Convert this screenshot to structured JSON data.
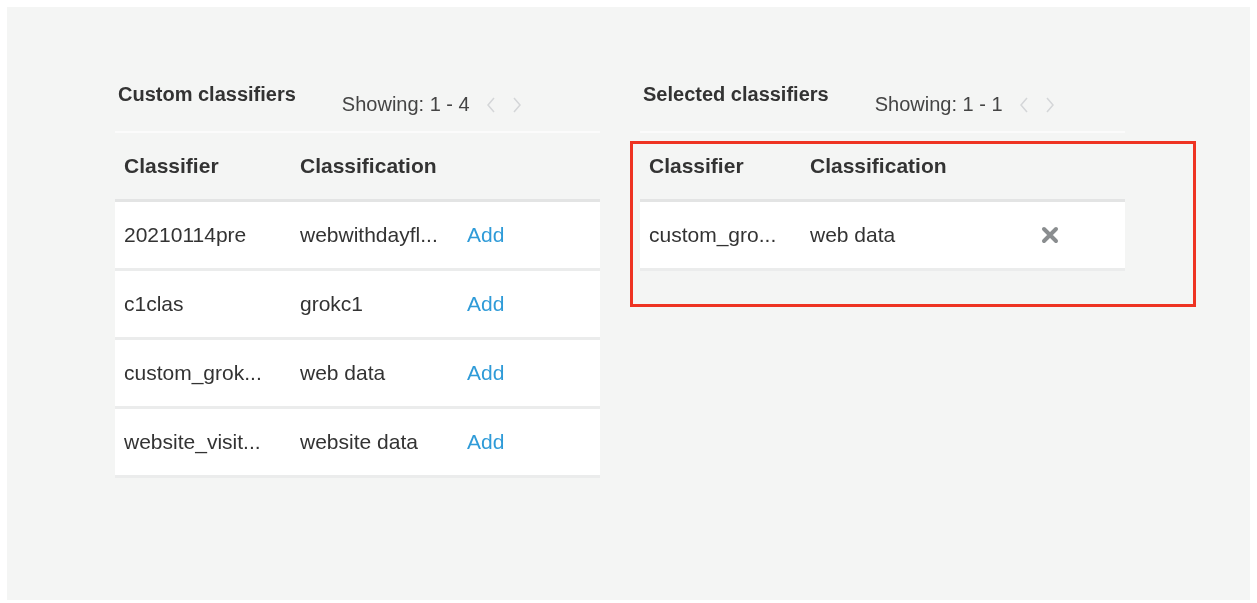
{
  "panels": [
    {
      "title": "Custom classifiers",
      "pager": {
        "text": "Showing: 1 - 4",
        "prev_disabled": true,
        "next_disabled": true
      },
      "highlighted": false,
      "columns": [
        "Classifier",
        "Classification"
      ],
      "kind": "add",
      "rows": [
        {
          "classifier": "20210114pre",
          "classification": "webwithdayfl...",
          "action_label": "Add"
        },
        {
          "classifier": "c1clas",
          "classification": "grokc1",
          "action_label": "Add"
        },
        {
          "classifier": "custom_grok...",
          "classification": "web data",
          "action_label": "Add"
        },
        {
          "classifier": "website_visit...",
          "classification": "website data",
          "action_label": "Add"
        }
      ]
    },
    {
      "title": "Selected classifiers",
      "pager": {
        "text": "Showing: 1 - 1",
        "prev_disabled": true,
        "next_disabled": true
      },
      "highlighted": true,
      "columns": [
        "Classifier",
        "Classification"
      ],
      "kind": "remove",
      "rows": [
        {
          "classifier": "custom_gro...",
          "classification": "web data"
        }
      ]
    }
  ]
}
